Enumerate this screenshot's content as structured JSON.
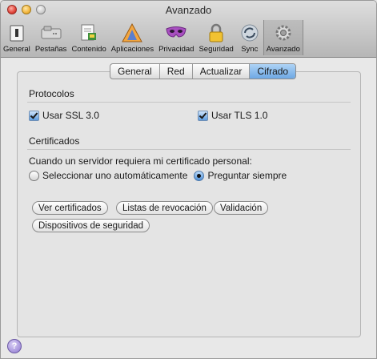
{
  "window": {
    "title": "Avanzado"
  },
  "toolbar": {
    "items": [
      {
        "label": "General",
        "icon": "general-icon"
      },
      {
        "label": "Pestañas",
        "icon": "tabs-icon"
      },
      {
        "label": "Contenido",
        "icon": "content-icon"
      },
      {
        "label": "Aplicaciones",
        "icon": "applications-icon"
      },
      {
        "label": "Privacidad",
        "icon": "privacy-mask-icon"
      },
      {
        "label": "Seguridad",
        "icon": "padlock-icon"
      },
      {
        "label": "Sync",
        "icon": "sync-icon"
      },
      {
        "label": "Avanzado",
        "icon": "gear-icon",
        "selected": true
      }
    ]
  },
  "subtabs": {
    "items": [
      "General",
      "Red",
      "Actualizar",
      "Cifrado"
    ],
    "active": "Cifrado"
  },
  "protocols": {
    "title": "Protocolos",
    "ssl": {
      "label": "Usar SSL 3.0",
      "checked": true
    },
    "tls": {
      "label": "Usar TLS 1.0",
      "checked": true
    }
  },
  "certificates": {
    "title": "Certificados",
    "prompt": "Cuando un servidor requiera mi certificado personal:",
    "radio_auto": {
      "label": "Seleccionar uno automáticamente",
      "checked": false
    },
    "radio_ask": {
      "label": "Preguntar siempre",
      "checked": true
    },
    "buttons": {
      "view": "Ver certificados",
      "revocation": "Listas de revocación",
      "validation": "Validación",
      "devices": "Dispositivos de seguridad"
    }
  },
  "help": {
    "label": "?"
  },
  "colors": {
    "accent": "#6ea8e4",
    "title_bar": "#c9c9c9"
  }
}
